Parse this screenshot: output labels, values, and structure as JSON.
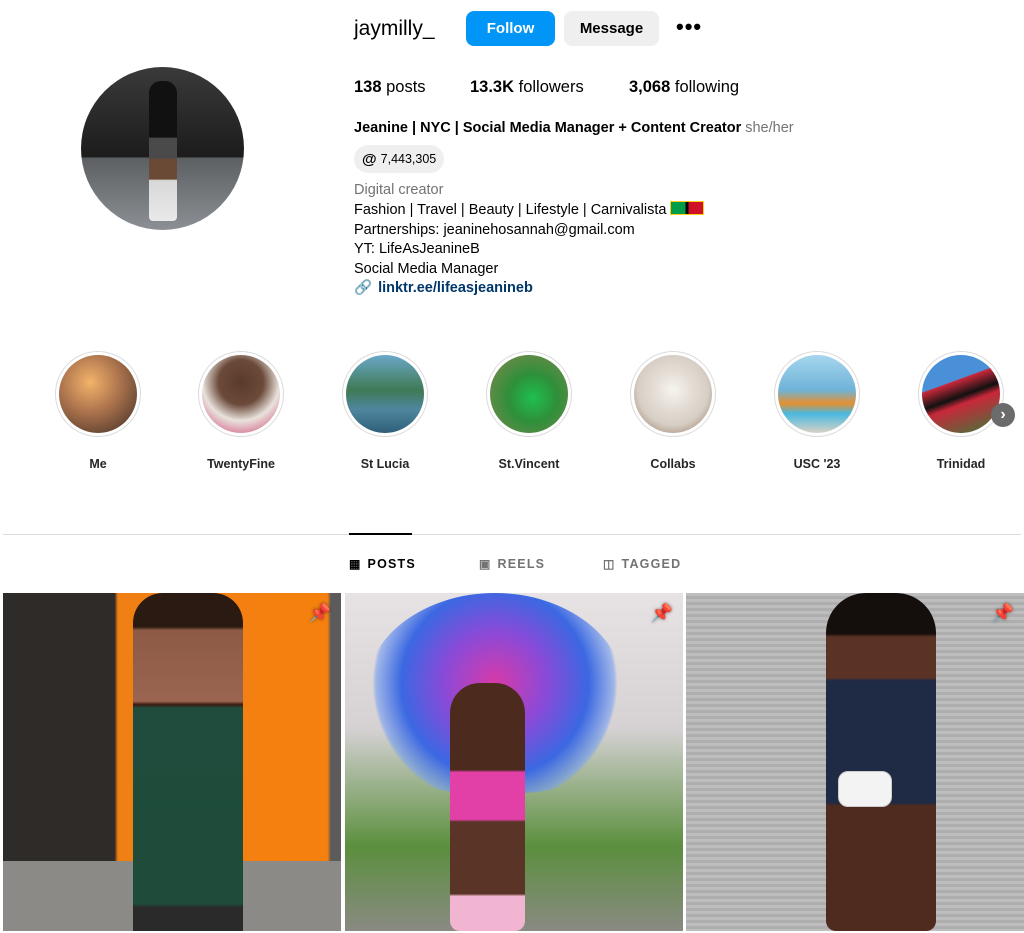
{
  "profile": {
    "username": "jaymilly_",
    "follow_label": "Follow",
    "message_label": "Message",
    "more_label": "•••",
    "posts_count": "138",
    "posts_label": " posts",
    "followers_count": "13.3K",
    "followers_label": " followers",
    "following_count": "3,068",
    "following_label": " following",
    "full_name": "Jeanine | NYC | Social Media Manager + Content Creator",
    "pronouns": "she/her",
    "threads_icon": "@",
    "threads_count": "7,443,305",
    "category": "Digital creator",
    "bio_lines": [
      "Fashion | Travel | Beauty | Lifestyle | Carnivalista",
      "Partnerships: jeaninehosannah@gmail.com",
      "YT: LifeAsJeanineB",
      "Social Media Manager"
    ],
    "link_icon": "🔗",
    "link": "linktr.ee/lifeasjeanineb"
  },
  "highlights": [
    {
      "label": "Me",
      "color": "#a9714c"
    },
    {
      "label": "TwentyFine",
      "color": "#6b4a3a"
    },
    {
      "label": "St Lucia",
      "color": "#4f86a0"
    },
    {
      "label": "St.Vincent",
      "color": "#2f8f3a"
    },
    {
      "label": "Collabs",
      "color": "#d7cfc6"
    },
    {
      "label": "USC '23",
      "color": "#6fb3d8"
    },
    {
      "label": "Trinidad",
      "color": "#c8283a"
    }
  ],
  "highlights_next_icon": "›",
  "tabs": [
    {
      "label": "POSTS",
      "icon": "▦",
      "active": true
    },
    {
      "label": "REELS",
      "icon": "▣",
      "active": false
    },
    {
      "label": "TAGGED",
      "icon": "◫",
      "active": false
    }
  ],
  "posts": [
    {
      "pinned": true
    },
    {
      "pinned": true
    },
    {
      "pinned": true
    }
  ],
  "pin_icon": "📌",
  "colors": {
    "accent": "#0095f6",
    "link": "#00376b",
    "secondary_text": "#737373"
  }
}
